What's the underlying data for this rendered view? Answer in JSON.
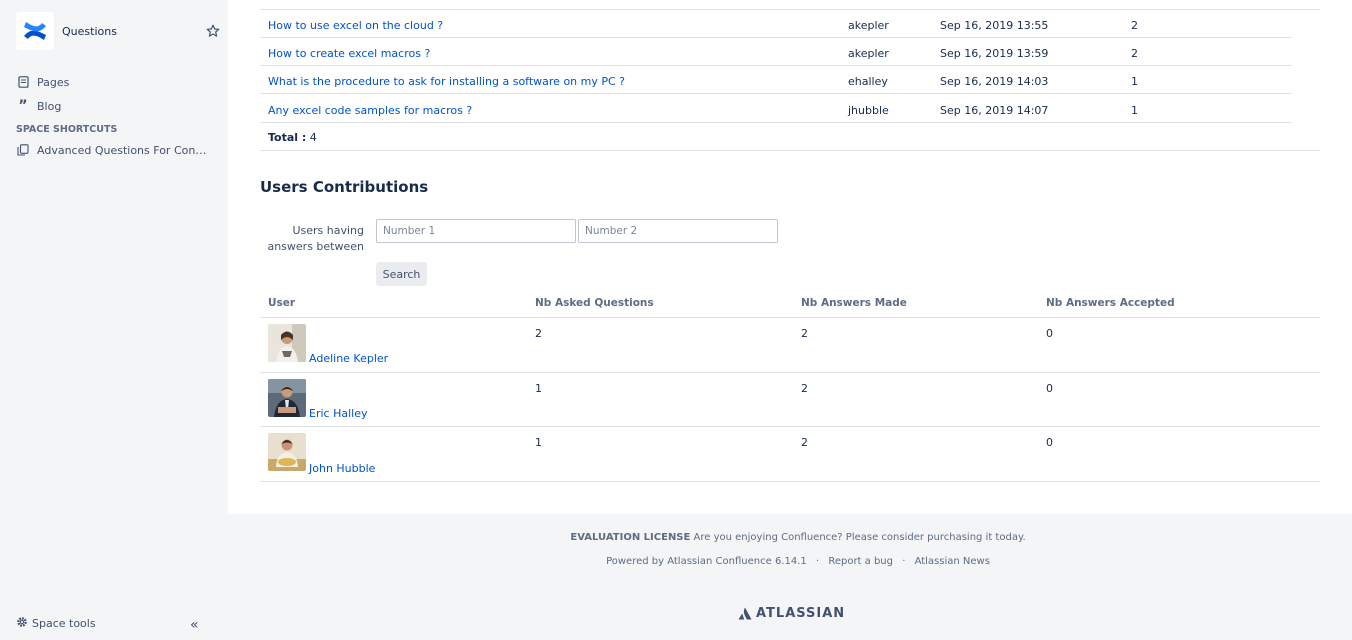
{
  "sidebar": {
    "space_title": "Questions",
    "nav": [
      {
        "label": "Pages",
        "icon": "pages-icon"
      },
      {
        "label": "Blog",
        "icon": "quote-icon"
      }
    ],
    "shortcuts_heading": "SPACE SHORTCUTS",
    "shortcuts": [
      {
        "label": "Advanced Questions For Confluence",
        "icon": "copy-icon"
      }
    ],
    "space_tools_label": "Space tools",
    "collapse_glyph": "«"
  },
  "questions_table": {
    "rows": [
      {
        "question": "How to use excel on the cloud ?",
        "author": "akepler",
        "date": "Sep 16, 2019 13:55",
        "answers": "2"
      },
      {
        "question": "How to create excel macros ?",
        "author": "akepler",
        "date": "Sep 16, 2019 13:59",
        "answers": "2"
      },
      {
        "question": "What is the procedure to ask for installing a software on my PC ?",
        "author": "ehalley",
        "date": "Sep 16, 2019 14:03",
        "answers": "1"
      },
      {
        "question": "Any excel code samples for macros ?",
        "author": "jhubble",
        "date": "Sep 16, 2019 14:07",
        "answers": "1"
      }
    ],
    "total_label": "Total :",
    "total_value": "4"
  },
  "users_contrib": {
    "title": "Users Contributions",
    "filter_label_line1": "Users having",
    "filter_label_line2": "answers between",
    "input1_placeholder": "Number 1",
    "input2_placeholder": "Number 2",
    "search_label": "Search",
    "headers": [
      "User",
      "Nb Asked Questions",
      "Nb Answers Made",
      "Nb Answers Accepted"
    ],
    "rows": [
      {
        "name": "Adeline Kepler",
        "asked": "2",
        "made": "2",
        "accepted": "0"
      },
      {
        "name": "Eric Halley",
        "asked": "1",
        "made": "2",
        "accepted": "0"
      },
      {
        "name": "John Hubble",
        "asked": "1",
        "made": "2",
        "accepted": "0"
      }
    ]
  },
  "footer": {
    "eval_bold": "EVALUATION LICENSE",
    "eval_text": "Are you enjoying Confluence? Please consider purchasing it today.",
    "powered": "Powered by Atlassian Confluence 6.14.1",
    "report_bug": "Report a bug",
    "news": "Atlassian News",
    "separator": "·",
    "brand": "ATLASSIAN"
  },
  "colors": {
    "link": "#0052cc",
    "sidebar_bg": "#f4f5f7",
    "confluence_blue": "#0052cc"
  }
}
